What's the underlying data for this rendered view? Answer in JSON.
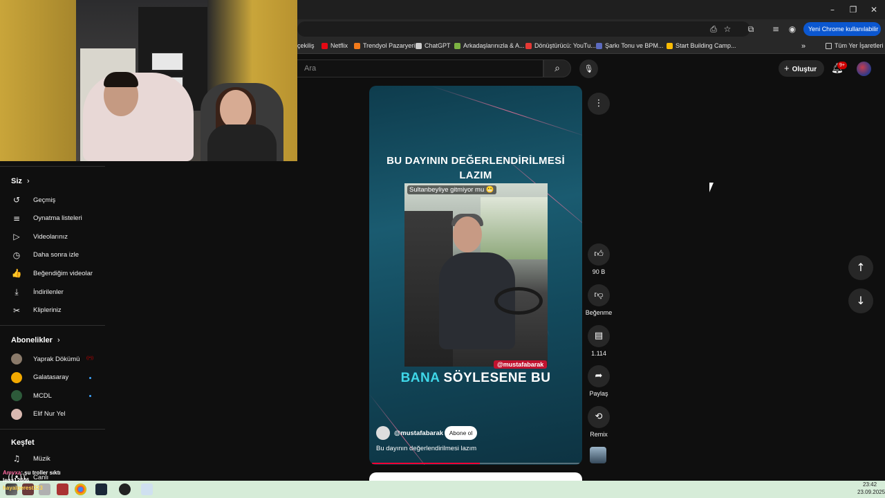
{
  "window": {
    "minimize": "–",
    "restore": "❐",
    "close": "✕"
  },
  "toolbar": {
    "chrome_badge": "Yeni Chrome kullanılabilir",
    "chrome_badge_menu": "⋮"
  },
  "bookmarks": [
    {
      "label": "çekiliş",
      "color": ""
    },
    {
      "label": "Netflix",
      "color": "#e50914"
    },
    {
      "label": "Trendyol Pazaryeri",
      "color": "#f27a1a"
    },
    {
      "label": "ChatGPT",
      "color": "#cccccc"
    },
    {
      "label": "Arkadaşlarınızla & A...",
      "color": "#7cb342"
    },
    {
      "label": "Dönüştürücü: YouTu...",
      "color": "#e53935"
    },
    {
      "label": "Şarkı Tonu ve BPM...",
      "color": "#5c6bc0"
    },
    {
      "label": "Start Building Camp...",
      "color": "#fbbc04"
    }
  ],
  "bookmarks_overflow": "»",
  "all_bookmarks": "Tüm Yer İşaretleri",
  "masthead": {
    "search_placeholder": "Ara",
    "create_label": "Oluştur",
    "notification_count": "9+"
  },
  "sidebar": {
    "you_title": "Siz",
    "you_items": [
      {
        "label": "Geçmiş",
        "icon": "history-icon",
        "glyph": "↺"
      },
      {
        "label": "Oynatma listeleri",
        "icon": "playlist-icon",
        "glyph": "≡"
      },
      {
        "label": "Videolarınız",
        "icon": "your-videos-icon",
        "glyph": "▷"
      },
      {
        "label": "Daha sonra izle",
        "icon": "watch-later-icon",
        "glyph": "◷"
      },
      {
        "label": "Beğendiğim videolar",
        "icon": "liked-icon",
        "glyph": "👍"
      },
      {
        "label": "İndirilenler",
        "icon": "download-icon",
        "glyph": "⤓"
      },
      {
        "label": "Klipleriniz",
        "icon": "clips-icon",
        "glyph": "✂"
      }
    ],
    "subs_title": "Abonelikler",
    "subs": [
      {
        "label": "Yaprak Dökümü",
        "color": "#8a7a6a",
        "status": "live"
      },
      {
        "label": "Galatasaray",
        "color": "#f2a900",
        "status": "new"
      },
      {
        "label": "MCDL",
        "color": "#2d5a3a",
        "status": "new"
      },
      {
        "label": "Elif Nur Yel",
        "color": "#d9b8b0",
        "status": ""
      }
    ],
    "explore_title": "Keşfet",
    "explore_items": [
      {
        "label": "Müzik",
        "icon": "music-icon",
        "glyph": "♫"
      }
    ],
    "partial_item": "Canlı"
  },
  "short": {
    "title": "BU DAYININ DEĞERLENDİRİLMESİ LAZIM",
    "clip_caption": "Sultanbeyliye gitmiyor mu 😬",
    "clip_handle": "@mustafabarak",
    "subtitle_highlight": "BANA",
    "subtitle_rest": "SÖYLESENE BU",
    "channel": "@mustafabarak",
    "subscribe_label": "Abone ol",
    "description": "Bu dayının değerlendirilmesi lazım",
    "progress": 0.52
  },
  "actions": {
    "like_count": "90 B",
    "dislike_label": "Beğenme",
    "comment_count": "1.114",
    "share_label": "Paylaş",
    "remix_label": "Remix"
  },
  "chat": {
    "user1": "Amvxa",
    "msg1": ": şu troller sıktı",
    "user2": "lena12346",
    "user3": "hayalperest323"
  },
  "clock": {
    "time": "23:42",
    "date": "23.09.2025"
  }
}
